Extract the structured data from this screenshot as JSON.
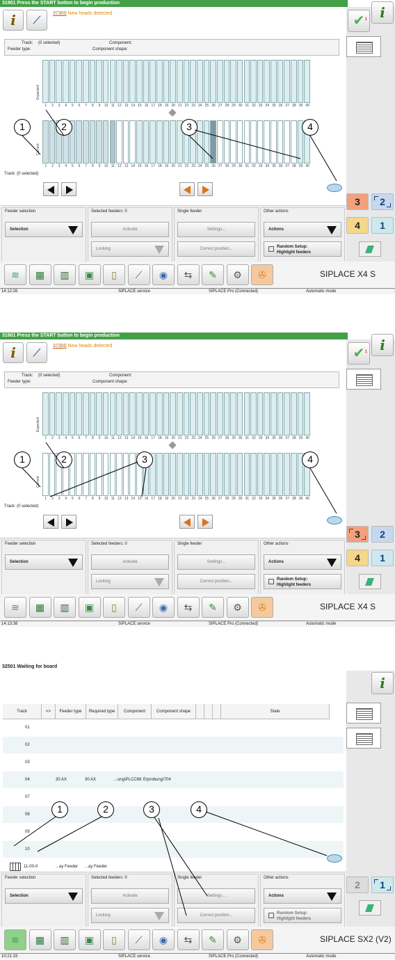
{
  "panels": [
    {
      "title": "31901 Press the START button to begin production",
      "warning_code": "37300",
      "warning_text": " New heads detected",
      "track_label": "Track:",
      "track_value": "(0 selected)",
      "component_label": "Component:",
      "feeder_type_label": "Feeder type:",
      "component_shape_label": "Component shape:",
      "expected_label": "Expected",
      "current_label": "Current",
      "track_footer": "Track:  (0 selected)",
      "callouts": [
        "1",
        "2",
        "3",
        "4"
      ],
      "machine": "SIPLACE X4 S",
      "time": "14:12:26",
      "status_items": [
        "SIPLACE service",
        "SIPLACE Pro (Connected)",
        "Automatic mode"
      ],
      "station_buttons": [
        "3",
        "2",
        "4",
        "1"
      ]
    },
    {
      "title": "31901 Press the START button to begin production",
      "warning_code": "37300",
      "warning_text": " New heads detected",
      "track_label": "Track:",
      "track_value": "(0 selected)",
      "component_label": "Component:",
      "feeder_type_label": "Feeder type:",
      "component_shape_label": "Component shape:",
      "expected_label": "Expected",
      "current_label": "Current",
      "track_footer": "Track:  (0 selected)",
      "callouts": [
        "1",
        "2",
        "3",
        "4"
      ],
      "machine": "SIPLACE X4 S",
      "time": "14:13:38",
      "status_items": [
        "SIPLACE service",
        "SIPLACE Pro (Connected)",
        "Automatic mode"
      ],
      "station_buttons": [
        "3",
        "2",
        "4",
        "1"
      ]
    },
    {
      "title": "32501 Waiting for board",
      "callouts": [
        "1",
        "2",
        "3",
        "4"
      ],
      "machine": "SIPLACE SX2 (V2)",
      "time": "10:21:33",
      "status_items": [
        "SIPLACE service",
        "SIPLACE Pro (Connected)",
        "Automatic mode"
      ],
      "station_buttons": [
        "2",
        "1"
      ],
      "table": {
        "columns": [
          "Track",
          "<>",
          "Feeder type",
          "Required type",
          "Component",
          "Component shape",
          "",
          "",
          "",
          "State"
        ],
        "rows": [
          {
            "track": "01",
            "ft": "",
            "rt": "",
            "comp": "",
            "shape": ""
          },
          {
            "track": "02",
            "ft": "",
            "rt": "",
            "comp": "",
            "shape": ""
          },
          {
            "track": "03",
            "ft": "",
            "rt": "",
            "comp": "",
            "shape": ""
          },
          {
            "track": "04",
            "ft": "30 AX",
            "rt": "30 AX",
            "comp": "...ung\\PLCC68",
            "shape": "Erprobung\\704"
          },
          {
            "track": "07",
            "ft": "",
            "rt": "",
            "comp": "",
            "shape": ""
          },
          {
            "track": "08",
            "ft": "",
            "rt": "",
            "comp": "",
            "shape": ""
          },
          {
            "track": "09",
            "ft": "",
            "rt": "",
            "comp": "",
            "shape": ""
          },
          {
            "track": "10",
            "ft": "",
            "rt": "",
            "comp": "",
            "shape": ""
          },
          {
            "track": "11-00-0",
            "ft": "...ay Feeder",
            "rt": "...ay Feeder",
            "comp": "",
            "shape": ""
          }
        ]
      }
    }
  ],
  "controls": {
    "feeder_selection": "Feeder selection",
    "selection": "Selection",
    "selected_feeders": "Selected feeders: 0",
    "activate": "Activate",
    "locking": "Locking",
    "single_feeder": "Single feeder",
    "settings": "Settings...",
    "correct_position": "Correct position...",
    "other_actions": "Other actions",
    "actions": "Actions",
    "random_setup_1": "Random Setup:",
    "random_setup_2": "Highlight feeders"
  },
  "rack": {
    "tracks": [
      "1",
      "2",
      "3",
      "4",
      "5",
      "6",
      "7",
      "8",
      "9",
      "10",
      "11",
      "12",
      "13",
      "14",
      "15",
      "16",
      "17",
      "18",
      "19",
      "20",
      "21",
      "22",
      "23",
      "24",
      "25",
      "26",
      "27",
      "28",
      "29",
      "30",
      "31",
      "32",
      "33",
      "34",
      "35",
      "36",
      "37",
      "38",
      "39",
      "40"
    ]
  },
  "icons": [
    "info-icon",
    "tool-icon",
    "check-icon",
    "list-icon",
    "feeder-overview-icon",
    "grid-icon",
    "bar-chart-icon",
    "module-icon",
    "clipboard-icon",
    "trend-chart-icon",
    "camera-icon",
    "conveyor-icon",
    "pen-icon",
    "gear-hand-icon",
    "wrench-icon",
    "refresh-icon",
    "exit-icon"
  ]
}
